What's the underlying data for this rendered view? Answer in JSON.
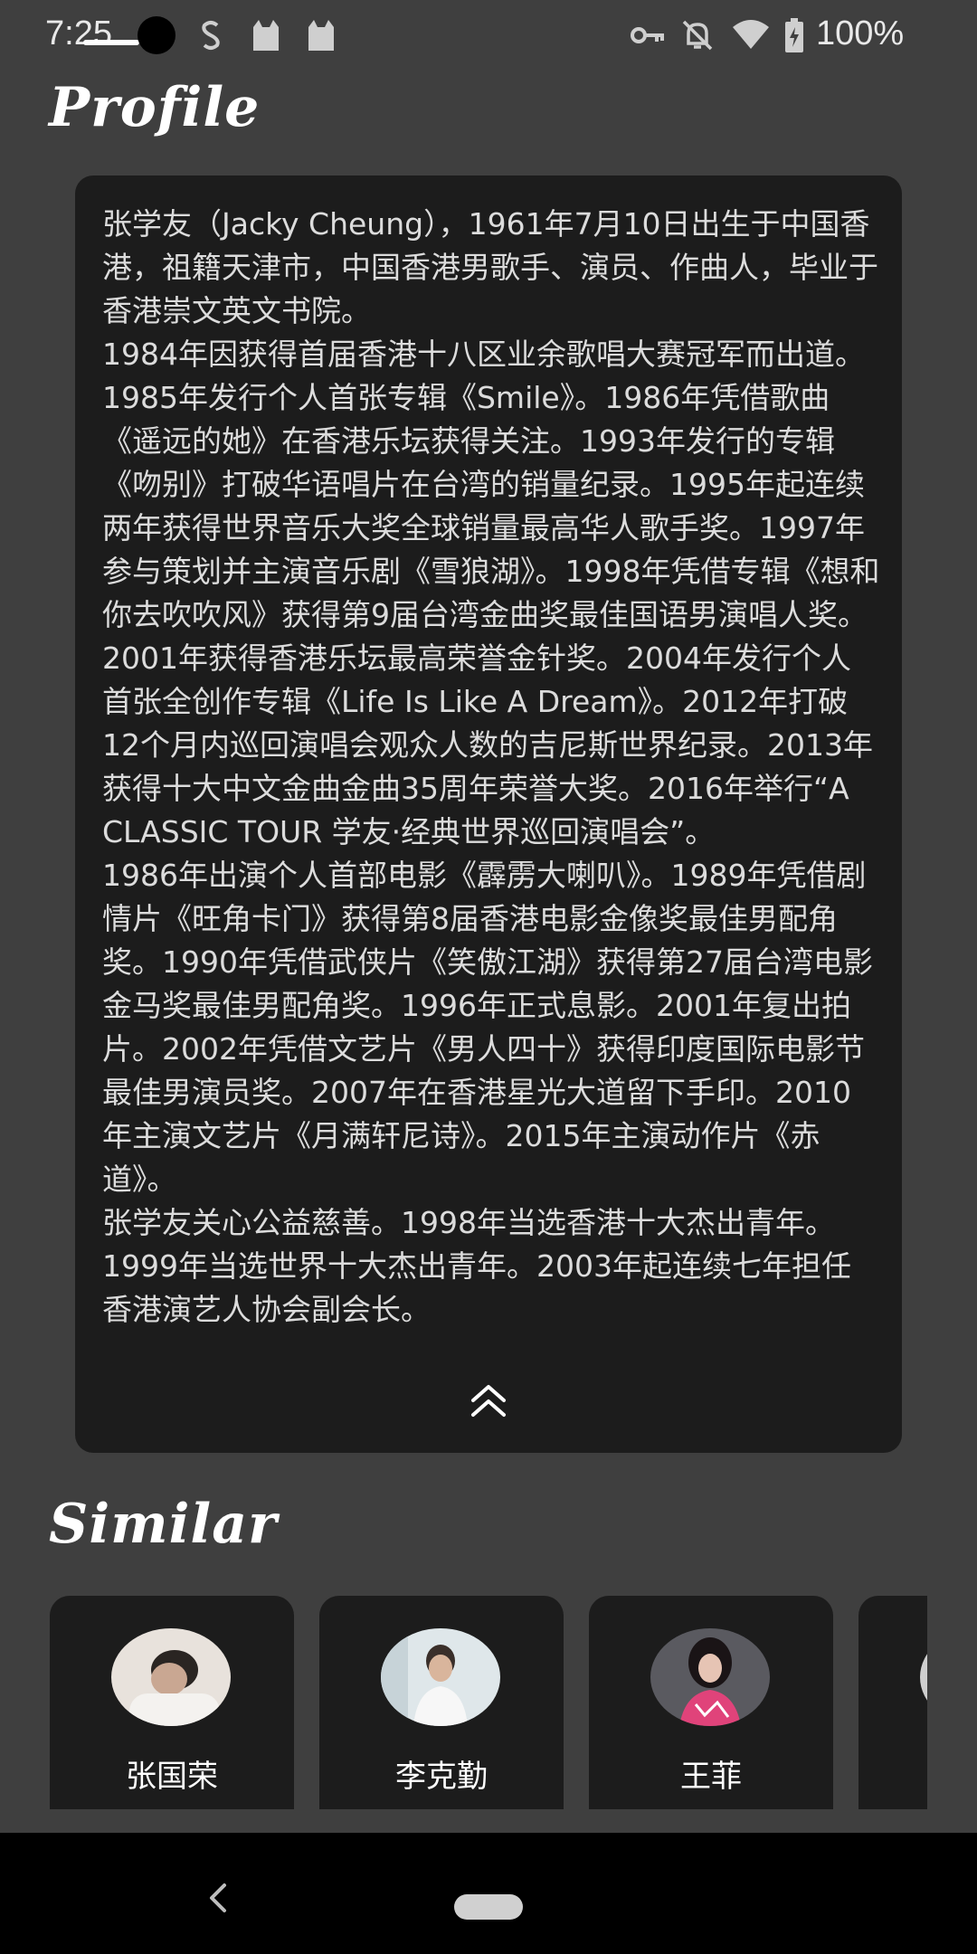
{
  "status_bar": {
    "time": "7:25",
    "battery_percent": "100%",
    "icons": [
      "notification-s-icon",
      "cat-icon",
      "cat-icon",
      "vpn-key-icon",
      "bell-off-icon",
      "wifi-icon",
      "battery-icon"
    ]
  },
  "profile": {
    "title": "Profile",
    "bio": "张学友（Jacky Cheung），1961年7月10日出生于中国香港，祖籍天津市，中国香港男歌手、演员、作曲人，毕业于香港崇文英文书院。\n1984年因获得首届香港十八区业余歌唱大赛冠军而出道。1985年发行个人首张专辑《Smile》。1986年凭借歌曲《遥远的她》在香港乐坛获得关注。1993年发行的专辑《吻别》打破华语唱片在台湾的销量纪录。1995年起连续两年获得世界音乐大奖全球销量最高华人歌手奖。1997年参与策划并主演音乐剧《雪狼湖》。1998年凭借专辑《想和你去吹吹风》获得第9届台湾金曲奖最佳国语男演唱人奖。2001年获得香港乐坛最高荣誉金针奖。2004年发行个人首张全创作专辑《Life Is Like A Dream》。2012年打破12个月内巡回演唱会观众人数的吉尼斯世界纪录。2013年获得十大中文金曲金曲35周年荣誉大奖。2016年举行“A CLASSIC TOUR 学友·经典世界巡回演唱会”。\n1986年出演个人首部电影《霹雳大喇叭》。1989年凭借剧情片《旺角卡门》获得第8届香港电影金像奖最佳男配角奖。1990年凭借武侠片《笑傲江湖》获得第27届台湾电影金马奖最佳男配角奖。1996年正式息影。2001年复出拍片。2002年凭借文艺片《男人四十》获得印度国际电影节最佳男演员奖。2007年在香港星光大道留下手印。2010年主演文艺片《月满轩尼诗》。2015年主演动作片《赤道》。\n张学友关心公益慈善。1998年当选香港十大杰出青年。1999年当选世界十大杰出青年。2003年起连续七年担任香港演艺人协会副会长。",
    "collapse_icon": "double-chevron-up-icon"
  },
  "similar": {
    "title": "Similar",
    "artists": [
      {
        "name": "张国荣"
      },
      {
        "name": "李克勤"
      },
      {
        "name": "王菲"
      },
      {
        "name": ""
      }
    ]
  },
  "nav_bar": {
    "back_icon": "back-chevron-icon",
    "home_icon": "home-pill-icon"
  },
  "colors": {
    "background": "#3f3f3f",
    "card": "#1c1c1c",
    "text": "#ffffff",
    "bio_text": "#dcdcdc"
  }
}
